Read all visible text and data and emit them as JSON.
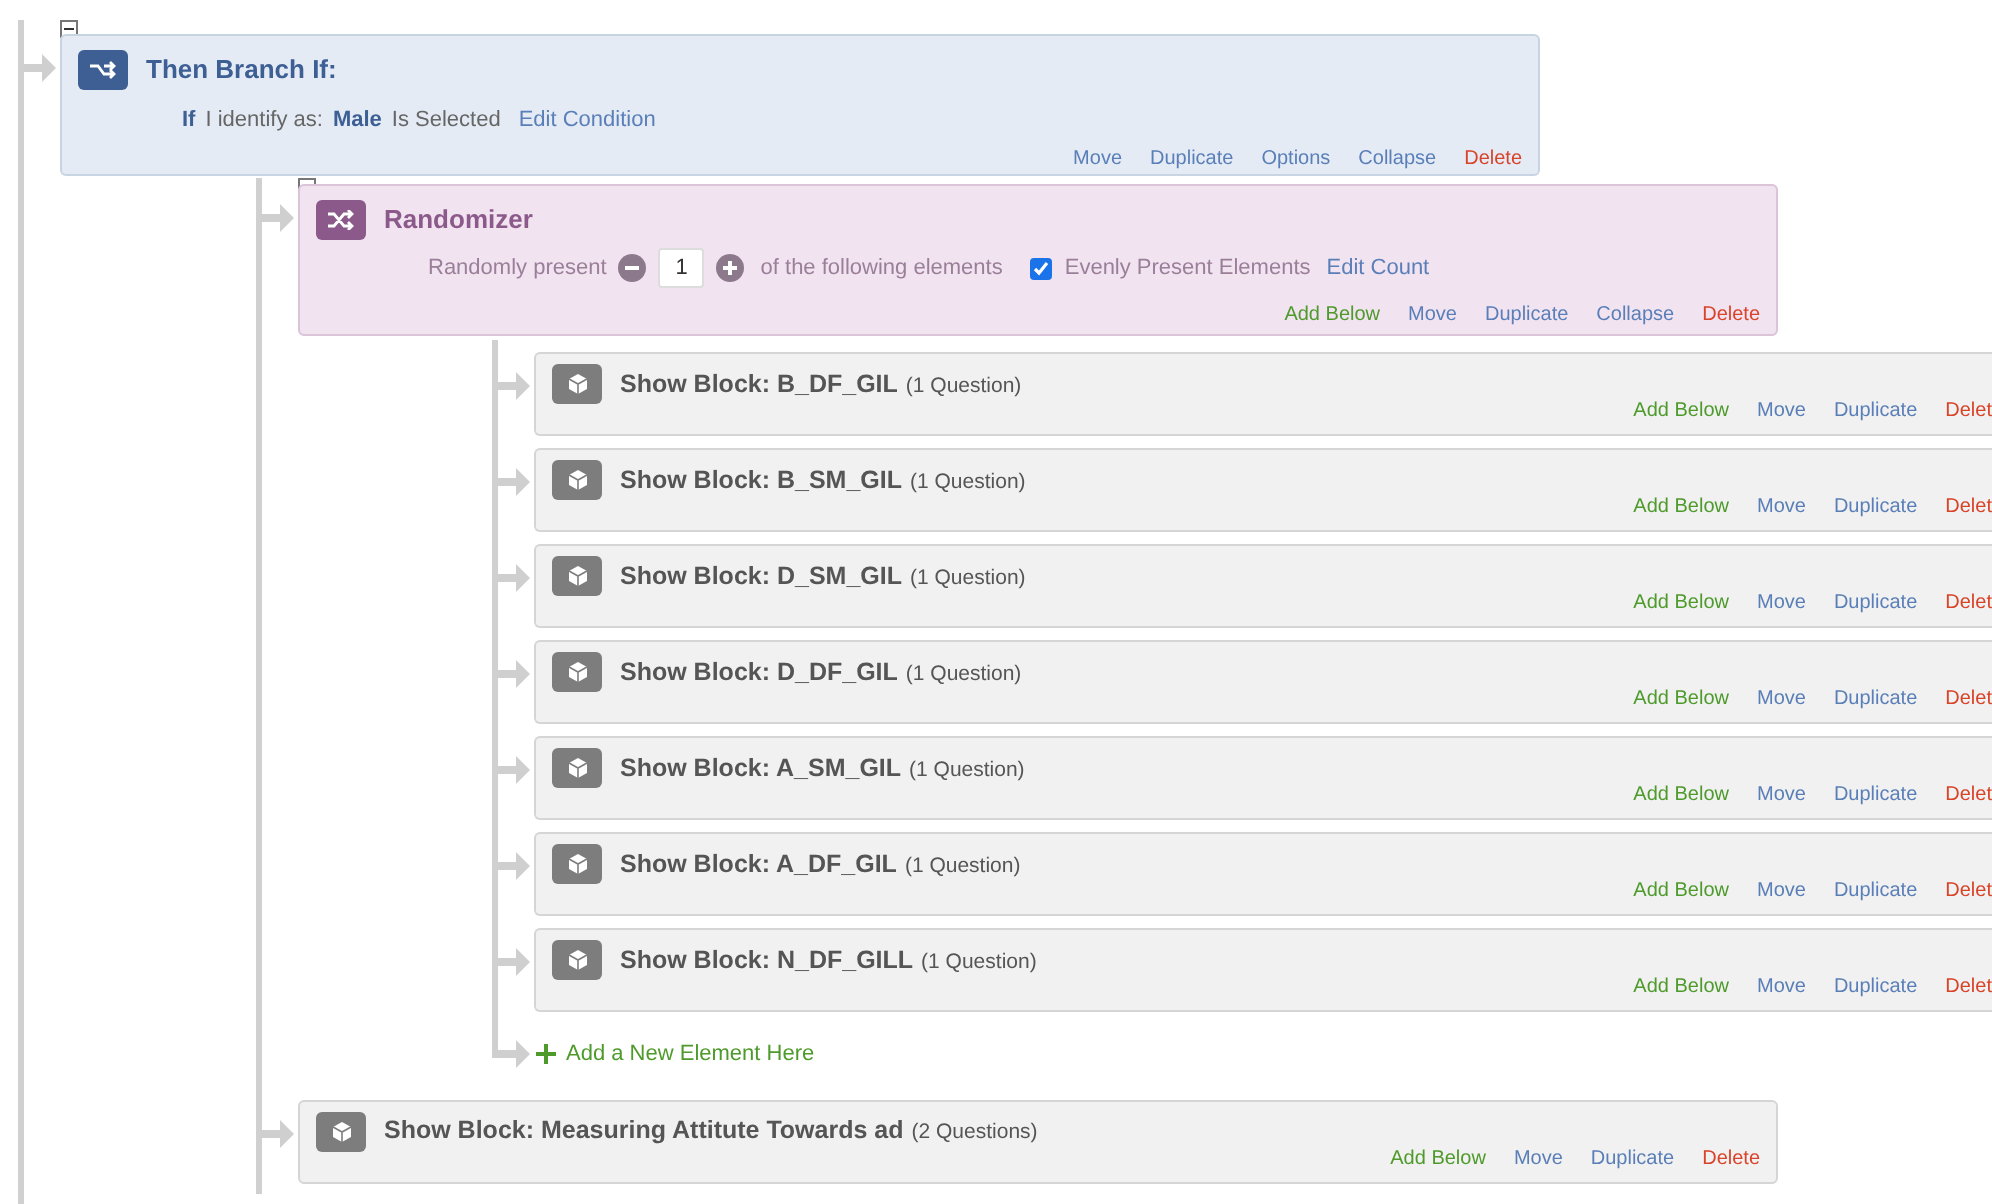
{
  "branch": {
    "title": "Then Branch If:",
    "condition": {
      "prefix": "If",
      "question": "I identify as:",
      "choice": "Male",
      "operator": "Is Selected",
      "link": "Edit Condition"
    },
    "actions": [
      {
        "label": "Move",
        "kind": "normal"
      },
      {
        "label": "Duplicate",
        "kind": "normal"
      },
      {
        "label": "Options",
        "kind": "normal"
      },
      {
        "label": "Collapse",
        "kind": "normal"
      },
      {
        "label": "Delete",
        "kind": "delete"
      }
    ]
  },
  "randomizer": {
    "title": "Randomizer",
    "present_label": "Randomly present",
    "count": "1",
    "suffix": "of the following elements",
    "evenly": {
      "label": "Evenly Present Elements",
      "checked": true
    },
    "link": "Edit Count",
    "actions": [
      {
        "label": "Add Below",
        "kind": "add"
      },
      {
        "label": "Move",
        "kind": "normal"
      },
      {
        "label": "Duplicate",
        "kind": "normal"
      },
      {
        "label": "Collapse",
        "kind": "normal"
      },
      {
        "label": "Delete",
        "kind": "delete"
      }
    ]
  },
  "blocks": [
    {
      "title": "Show Block: B_DF_GIL",
      "questions": "(1 Question)",
      "actions": [
        {
          "label": "Add Below",
          "kind": "add"
        },
        {
          "label": "Move",
          "kind": "normal"
        },
        {
          "label": "Duplicate",
          "kind": "normal"
        },
        {
          "label": "Delet",
          "kind": "delete"
        }
      ]
    },
    {
      "title": "Show Block: B_SM_GIL",
      "questions": "(1 Question)",
      "actions": [
        {
          "label": "Add Below",
          "kind": "add"
        },
        {
          "label": "Move",
          "kind": "normal"
        },
        {
          "label": "Duplicate",
          "kind": "normal"
        },
        {
          "label": "Delet",
          "kind": "delete"
        }
      ]
    },
    {
      "title": "Show Block: D_SM_GIL",
      "questions": "(1 Question)",
      "actions": [
        {
          "label": "Add Below",
          "kind": "add"
        },
        {
          "label": "Move",
          "kind": "normal"
        },
        {
          "label": "Duplicate",
          "kind": "normal"
        },
        {
          "label": "Delet",
          "kind": "delete"
        }
      ]
    },
    {
      "title": "Show Block: D_DF_GIL",
      "questions": "(1 Question)",
      "actions": [
        {
          "label": "Add Below",
          "kind": "add"
        },
        {
          "label": "Move",
          "kind": "normal"
        },
        {
          "label": "Duplicate",
          "kind": "normal"
        },
        {
          "label": "Delet",
          "kind": "delete"
        }
      ]
    },
    {
      "title": "Show Block: A_SM_GIL",
      "questions": "(1 Question)",
      "actions": [
        {
          "label": "Add Below",
          "kind": "add"
        },
        {
          "label": "Move",
          "kind": "normal"
        },
        {
          "label": "Duplicate",
          "kind": "normal"
        },
        {
          "label": "Delet",
          "kind": "delete"
        }
      ]
    },
    {
      "title": "Show Block: A_DF_GIL",
      "questions": "(1 Question)",
      "actions": [
        {
          "label": "Add Below",
          "kind": "add"
        },
        {
          "label": "Move",
          "kind": "normal"
        },
        {
          "label": "Duplicate",
          "kind": "normal"
        },
        {
          "label": "Delet",
          "kind": "delete"
        }
      ]
    },
    {
      "title": "Show Block: N_DF_GILL",
      "questions": "(1 Question)",
      "actions": [
        {
          "label": "Add Below",
          "kind": "add"
        },
        {
          "label": "Move",
          "kind": "normal"
        },
        {
          "label": "Duplicate",
          "kind": "normal"
        },
        {
          "label": "Delet",
          "kind": "delete"
        }
      ]
    }
  ],
  "add_element": {
    "label": "Add a New Element Here"
  },
  "final_block": {
    "title": "Show Block: Measuring Attitute Towards ad",
    "questions": "(2 Questions)",
    "actions": [
      {
        "label": "Add Below",
        "kind": "add"
      },
      {
        "label": "Move",
        "kind": "normal"
      },
      {
        "label": "Duplicate",
        "kind": "normal"
      },
      {
        "label": "Delete",
        "kind": "delete"
      }
    ]
  }
}
